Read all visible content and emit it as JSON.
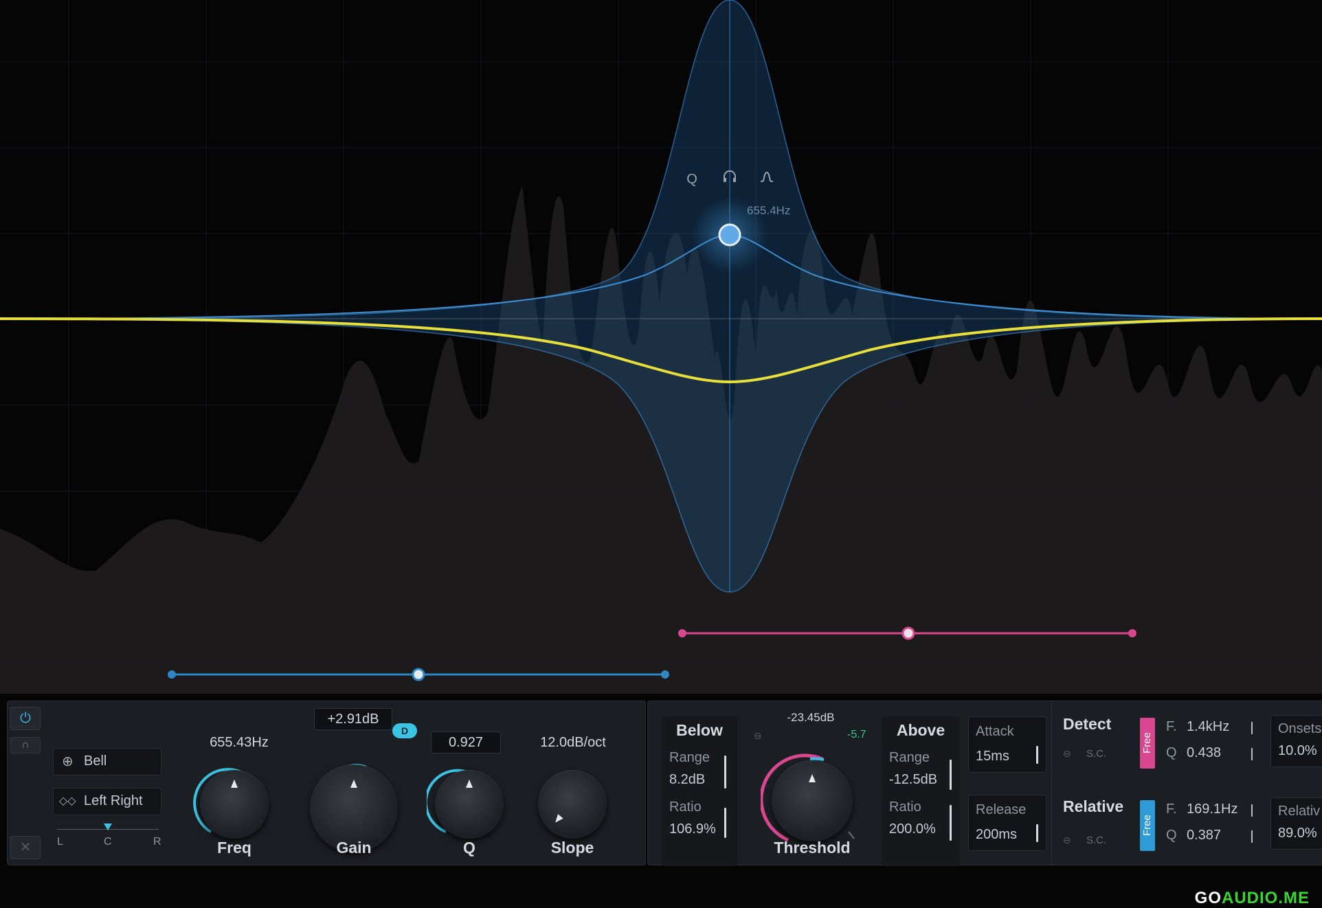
{
  "band": {
    "freq_tooltip": "655.4Hz",
    "toolbar_icons": [
      "q-icon",
      "headphones-icon",
      "bell-shape-icon"
    ]
  },
  "controls": {
    "shape_label": "Bell",
    "stereo_label": "Left Right",
    "pan_labels": [
      "L",
      "C",
      "R"
    ],
    "freq": {
      "label": "Freq",
      "value": "655.43Hz"
    },
    "gain": {
      "label": "Gain",
      "value": "+2.91dB",
      "badge": "D"
    },
    "q": {
      "label": "Q",
      "value": "0.927"
    },
    "slope": {
      "label": "Slope",
      "value": "12.0dB/oct"
    }
  },
  "dynamics": {
    "below": {
      "title": "Below",
      "range_label": "Range",
      "range_value": "8.2dB",
      "ratio_label": "Ratio",
      "ratio_value": "106.9%"
    },
    "threshold": {
      "label": "Threshold",
      "value": "-23.45dB",
      "offset": "-5.7"
    },
    "above": {
      "title": "Above",
      "range_label": "Range",
      "range_value": "-12.5dB",
      "ratio_label": "Ratio",
      "ratio_value": "200.0%"
    },
    "attack": {
      "label": "Attack",
      "value": "15ms"
    },
    "release": {
      "label": "Release",
      "value": "200ms"
    }
  },
  "detect": {
    "title": "Detect",
    "tag": "Free",
    "sc": "S.C.",
    "f_label": "F.",
    "f_value": "1.4kHz",
    "q_label": "Q",
    "q_value": "0.438",
    "onsets_label": "Onsets",
    "onsets_value": "10.0%"
  },
  "relative": {
    "title": "Relative",
    "tag": "Free",
    "sc": "S.C.",
    "f_label": "F.",
    "f_value": "169.1Hz",
    "q_label": "Q",
    "q_value": "0.387",
    "rel_label": "Relativ",
    "rel_value": "89.0%"
  },
  "colors": {
    "accent": "#3bc3e3",
    "eq_curve": "#e8df3a",
    "band_blue": "#2f86c4",
    "pink": "#d8478f"
  },
  "watermark": {
    "part1": "GO",
    "part2": "AUDIO.ME"
  }
}
